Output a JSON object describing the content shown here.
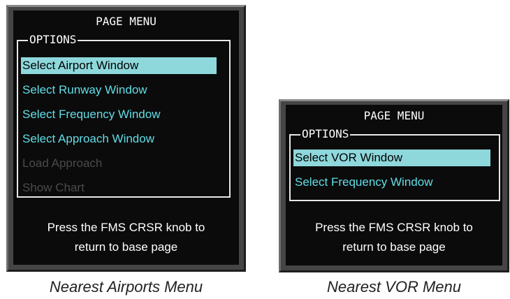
{
  "colors": {
    "bezel": "#454545",
    "screen": "#0b0b0b",
    "item_text": "#62dde6",
    "selected_bg": "#8ed8dc",
    "disabled_text": "#4a4a4a"
  },
  "airports_menu": {
    "title": "PAGE MENU",
    "options_label": "OPTIONS",
    "items": [
      {
        "label": "Select Airport Window",
        "state": "selected"
      },
      {
        "label": "Select Runway Window",
        "state": "enabled"
      },
      {
        "label": "Select Frequency Window",
        "state": "enabled"
      },
      {
        "label": "Select Approach Window",
        "state": "enabled"
      },
      {
        "label": "Load Approach",
        "state": "disabled"
      },
      {
        "label": "Show Chart",
        "state": "disabled"
      }
    ],
    "footer_line1": "Press the FMS CRSR knob to",
    "footer_line2": "return to base page",
    "caption": "Nearest Airports Menu"
  },
  "vor_menu": {
    "title": "PAGE MENU",
    "options_label": "OPTIONS",
    "items": [
      {
        "label": "Select VOR Window",
        "state": "selected"
      },
      {
        "label": "Select Frequency Window",
        "state": "enabled"
      }
    ],
    "footer_line1": "Press the FMS CRSR knob to",
    "footer_line2": "return to base page",
    "caption": "Nearest VOR Menu"
  }
}
